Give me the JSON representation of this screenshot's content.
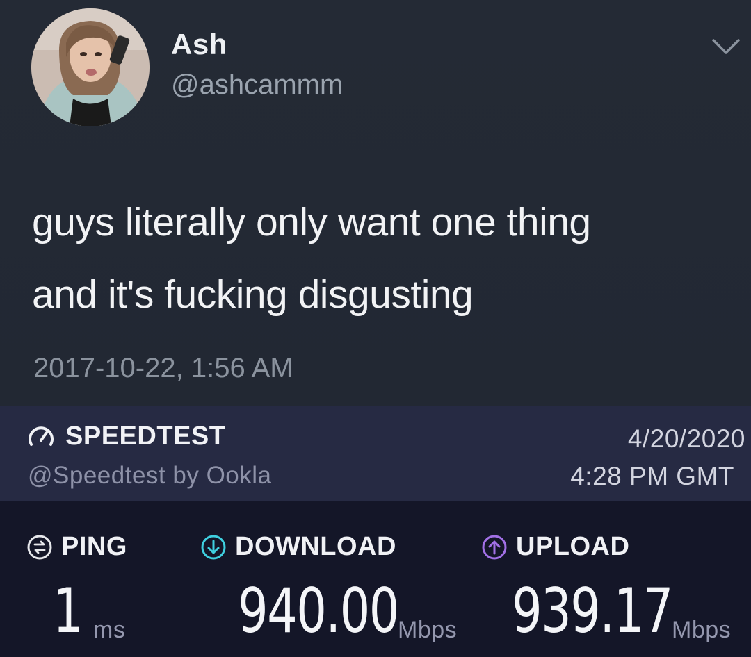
{
  "tweet": {
    "author_name": "Ash",
    "author_handle": "@ashcammm",
    "text_lines": [
      "guys literally only want one thing",
      "and it's fucking disgusting"
    ],
    "timestamp": "2017-10-22, 1:56 AM",
    "menu_icon": "chevron-down-icon"
  },
  "speedtest": {
    "brand": "SPEEDTEST",
    "handle": "@Speedtest by Ookla",
    "date": "4/20/2020",
    "time": "4:28 PM GMT",
    "metrics": {
      "ping": {
        "label": "PING",
        "value": "1",
        "unit": "ms",
        "icon": "ping-icon",
        "color": "#e7e8ec"
      },
      "download": {
        "label": "DOWNLOAD",
        "value": "940.00",
        "unit": "Mbps",
        "icon": "download-icon",
        "color": "#3fd0e0"
      },
      "upload": {
        "label": "UPLOAD",
        "value": "939.17",
        "unit": "Mbps",
        "icon": "upload-icon",
        "color": "#a270e6"
      }
    }
  }
}
